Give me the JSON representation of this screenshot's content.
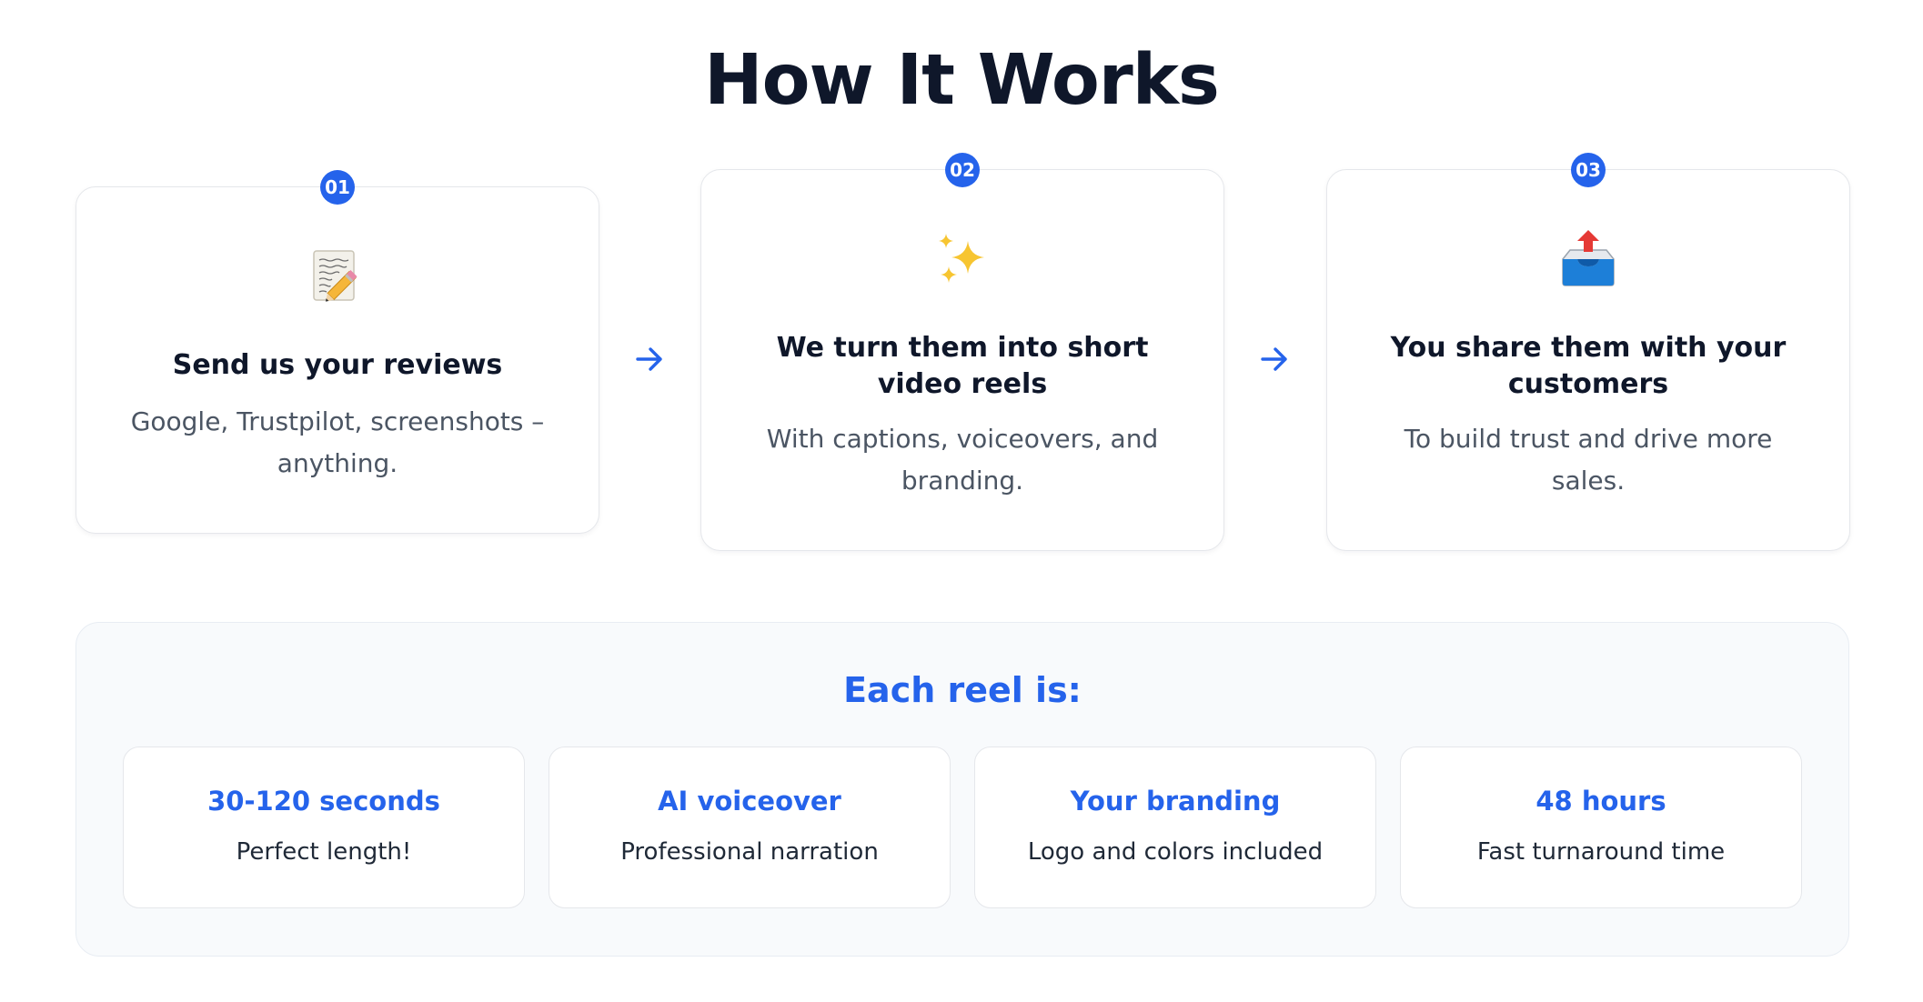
{
  "section": {
    "title": "How It Works"
  },
  "steps": [
    {
      "number": "01",
      "icon": "memo-icon",
      "title": "Send us your reviews",
      "description": "Google, Trustpilot, screenshots – anything."
    },
    {
      "number": "02",
      "icon": "sparkles-icon",
      "title": "We turn them into short video reels",
      "description": "With captions, voiceovers, and branding."
    },
    {
      "number": "03",
      "icon": "outbox-tray-icon",
      "title": "You share them with your customers",
      "description": "To build trust and drive more sales."
    }
  ],
  "features": {
    "title": "Each reel is:",
    "items": [
      {
        "title": "30-120 seconds",
        "description": "Perfect length!"
      },
      {
        "title": "AI voiceover",
        "description": "Professional narration"
      },
      {
        "title": "Your branding",
        "description": "Logo and colors included"
      },
      {
        "title": "48 hours",
        "description": "Fast turnaround time"
      }
    ]
  },
  "colors": {
    "accent": "#2563eb",
    "heading": "#0f172a",
    "body_text": "#4b5563",
    "panel_bg": "#f8fafc"
  }
}
